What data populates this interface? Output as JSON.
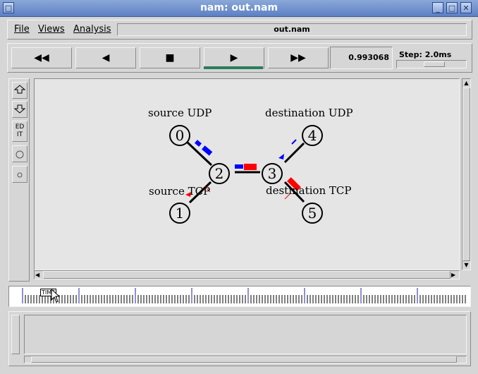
{
  "window": {
    "title": "nam: out.nam"
  },
  "title_buttons": {
    "menu": "□",
    "minimize": "_",
    "maximize": "□",
    "close": "✕"
  },
  "menu": {
    "file": "File",
    "views": "Views",
    "analysis": "Analysis",
    "filename": "out.nam"
  },
  "controls": {
    "rewind": "◀◀",
    "back": "◀",
    "stop": "■",
    "play": "▶",
    "ffwd": "▶▶",
    "time": "0.993068",
    "step_label": "Step: 2.0ms"
  },
  "side_tools": {
    "edit": "ED\nIT"
  },
  "network": {
    "nodes": [
      "0",
      "1",
      "2",
      "3",
      "4",
      "5"
    ],
    "labels": {
      "src_udp": "source UDP",
      "dst_udp": "destination UDP",
      "src_tcp": "source TCP",
      "dst_tcp": "destination TCP"
    }
  },
  "timeline": {
    "marker": "TIME"
  },
  "colors": {
    "packet_udp": "#0000ff",
    "packet_tcp": "#ff0000",
    "play_indicator": "#2e7d5b"
  }
}
